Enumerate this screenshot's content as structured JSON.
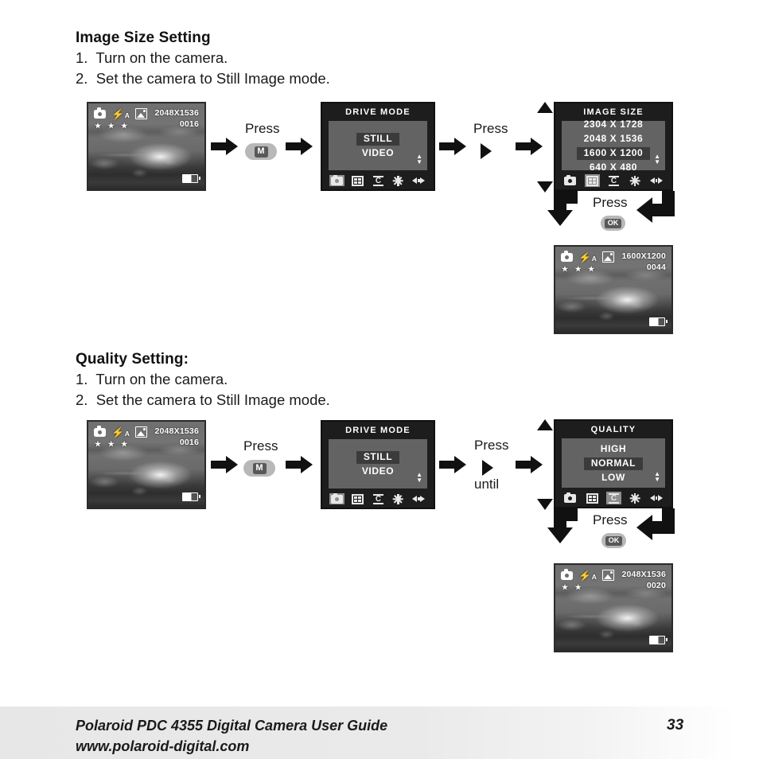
{
  "page": {
    "number": "33",
    "footer_line1": "Polaroid PDC 4355 Digital Camera User Guide",
    "footer_line2": "www.polaroid-digital.com"
  },
  "sections": [
    {
      "title": "Image Size Setting",
      "steps": [
        "1.  Turn on the camera.",
        "2.  Set the camera to Still Image mode."
      ],
      "start_lcd": {
        "resolution": "2048X1536",
        "counter": "0016",
        "stars": "★ ★ ★",
        "icons": [
          "camera-icon",
          "flash-auto-icon",
          "scene-frame-icon",
          "battery-icon"
        ]
      },
      "press1": {
        "label": "Press",
        "button": "M"
      },
      "menu1": {
        "title": "DRIVE MODE",
        "options": [
          "STILL",
          "VIDEO"
        ],
        "selected": "STILL",
        "bar_icons": [
          "camera-icon",
          "image-size-icon",
          "quality-icon",
          "brightness-icon",
          "left-right-icon"
        ],
        "bar_highlight": 0
      },
      "press2": {
        "label": "Press",
        "symbol": "▶",
        "sublabel": ""
      },
      "menu2": {
        "title": "IMAGE SIZE",
        "options": [
          "2304 X 1728",
          "2048 X 1536",
          "1600 X 1200",
          "640 X 480"
        ],
        "selected": "1600 X 1200",
        "bar_icons": [
          "camera-icon",
          "image-size-icon",
          "quality-icon",
          "brightness-icon",
          "left-right-icon"
        ],
        "bar_highlight": 1
      },
      "press3": {
        "label": "Press",
        "button": "OK"
      },
      "result_lcd": {
        "resolution": "1600X1200",
        "counter": "0044",
        "stars": "★ ★ ★",
        "icons": [
          "camera-icon",
          "flash-auto-icon",
          "scene-frame-icon",
          "battery-icon"
        ]
      }
    },
    {
      "title": "Quality Setting:",
      "steps": [
        "1.  Turn on the camera.",
        "2.  Set the camera to Still Image mode."
      ],
      "start_lcd": {
        "resolution": "2048X1536",
        "counter": "0016",
        "stars": "★ ★ ★",
        "icons": [
          "camera-icon",
          "flash-auto-icon",
          "scene-frame-icon",
          "battery-icon"
        ]
      },
      "press1": {
        "label": "Press",
        "button": "M"
      },
      "menu1": {
        "title": "DRIVE MODE",
        "options": [
          "STILL",
          "VIDEO"
        ],
        "selected": "STILL",
        "bar_icons": [
          "camera-icon",
          "image-size-icon",
          "quality-icon",
          "brightness-icon",
          "left-right-icon"
        ],
        "bar_highlight": 0
      },
      "press2": {
        "label": "Press",
        "symbol": "▶",
        "sublabel": "until"
      },
      "menu2": {
        "title": "QUALITY",
        "options": [
          "HIGH",
          "NORMAL",
          "LOW"
        ],
        "selected": "NORMAL",
        "bar_icons": [
          "camera-icon",
          "image-size-icon",
          "quality-icon",
          "brightness-icon",
          "left-right-icon"
        ],
        "bar_highlight": 2
      },
      "press3": {
        "label": "Press",
        "button": "OK"
      },
      "result_lcd": {
        "resolution": "2048X1536",
        "counter": "0020",
        "stars": "★ ★",
        "icons": [
          "camera-icon",
          "flash-auto-icon",
          "scene-frame-icon",
          "battery-icon"
        ]
      }
    }
  ],
  "colors": {
    "ink": "#1a1a1a",
    "menu_bg": "#1d1d1d",
    "menu_body": "#636363",
    "selection": "#3b3b3b",
    "button_pill": "#b8b8b8",
    "button_cap": "#585858"
  }
}
